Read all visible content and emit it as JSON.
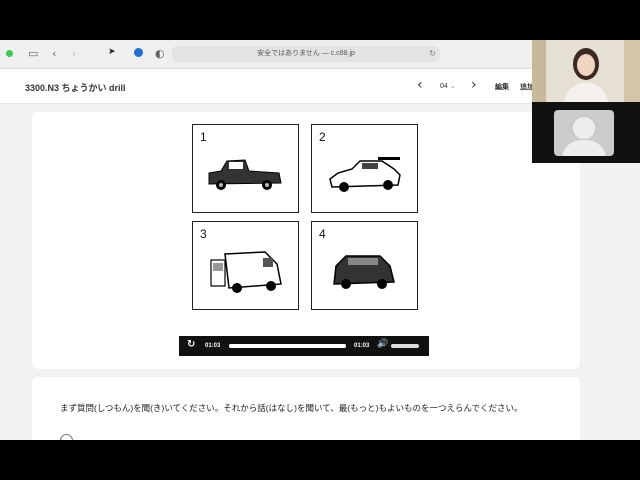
{
  "browser": {
    "url_text": "安全ではありません — c.c88.jp",
    "icons": [
      "sidebar-icon",
      "back-chevron-icon",
      "forward-chevron-icon",
      "extension-icon",
      "shield-icon",
      "reload-icon"
    ]
  },
  "app": {
    "title": "3300.N3 ちょうかい drill",
    "page_value": "04",
    "edit_label": "編集",
    "add_label": "追加"
  },
  "question": {
    "panels": [
      {
        "num": "1",
        "icon": "pickup-truck-image"
      },
      {
        "num": "2",
        "icon": "sports-car-image"
      },
      {
        "num": "3",
        "icon": "minivan-open-door-image"
      },
      {
        "num": "4",
        "icon": "compact-car-image"
      }
    ],
    "audio": {
      "current_time": "01:03",
      "duration": "01:03",
      "progress": 1.0
    },
    "instruction": "まず質問(しつもん)を聞(き)いてください。それから話(はなし)を聞いて、最(もっと)もよいものを一つえらんでください。"
  },
  "colors": {
    "traffic_green": "#3cc84a",
    "edge_blue": "#1f6fd6"
  }
}
